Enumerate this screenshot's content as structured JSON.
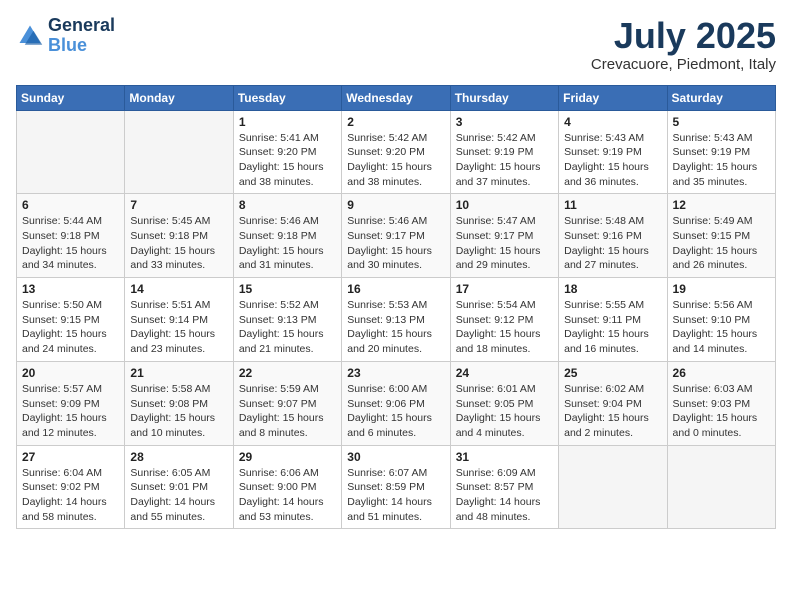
{
  "header": {
    "logo_line1": "General",
    "logo_line2": "Blue",
    "month": "July 2025",
    "location": "Crevacuore, Piedmont, Italy"
  },
  "weekdays": [
    "Sunday",
    "Monday",
    "Tuesday",
    "Wednesday",
    "Thursday",
    "Friday",
    "Saturday"
  ],
  "weeks": [
    [
      {
        "day": "",
        "text": ""
      },
      {
        "day": "",
        "text": ""
      },
      {
        "day": "1",
        "text": "Sunrise: 5:41 AM\nSunset: 9:20 PM\nDaylight: 15 hours and 38 minutes."
      },
      {
        "day": "2",
        "text": "Sunrise: 5:42 AM\nSunset: 9:20 PM\nDaylight: 15 hours and 38 minutes."
      },
      {
        "day": "3",
        "text": "Sunrise: 5:42 AM\nSunset: 9:19 PM\nDaylight: 15 hours and 37 minutes."
      },
      {
        "day": "4",
        "text": "Sunrise: 5:43 AM\nSunset: 9:19 PM\nDaylight: 15 hours and 36 minutes."
      },
      {
        "day": "5",
        "text": "Sunrise: 5:43 AM\nSunset: 9:19 PM\nDaylight: 15 hours and 35 minutes."
      }
    ],
    [
      {
        "day": "6",
        "text": "Sunrise: 5:44 AM\nSunset: 9:18 PM\nDaylight: 15 hours and 34 minutes."
      },
      {
        "day": "7",
        "text": "Sunrise: 5:45 AM\nSunset: 9:18 PM\nDaylight: 15 hours and 33 minutes."
      },
      {
        "day": "8",
        "text": "Sunrise: 5:46 AM\nSunset: 9:18 PM\nDaylight: 15 hours and 31 minutes."
      },
      {
        "day": "9",
        "text": "Sunrise: 5:46 AM\nSunset: 9:17 PM\nDaylight: 15 hours and 30 minutes."
      },
      {
        "day": "10",
        "text": "Sunrise: 5:47 AM\nSunset: 9:17 PM\nDaylight: 15 hours and 29 minutes."
      },
      {
        "day": "11",
        "text": "Sunrise: 5:48 AM\nSunset: 9:16 PM\nDaylight: 15 hours and 27 minutes."
      },
      {
        "day": "12",
        "text": "Sunrise: 5:49 AM\nSunset: 9:15 PM\nDaylight: 15 hours and 26 minutes."
      }
    ],
    [
      {
        "day": "13",
        "text": "Sunrise: 5:50 AM\nSunset: 9:15 PM\nDaylight: 15 hours and 24 minutes."
      },
      {
        "day": "14",
        "text": "Sunrise: 5:51 AM\nSunset: 9:14 PM\nDaylight: 15 hours and 23 minutes."
      },
      {
        "day": "15",
        "text": "Sunrise: 5:52 AM\nSunset: 9:13 PM\nDaylight: 15 hours and 21 minutes."
      },
      {
        "day": "16",
        "text": "Sunrise: 5:53 AM\nSunset: 9:13 PM\nDaylight: 15 hours and 20 minutes."
      },
      {
        "day": "17",
        "text": "Sunrise: 5:54 AM\nSunset: 9:12 PM\nDaylight: 15 hours and 18 minutes."
      },
      {
        "day": "18",
        "text": "Sunrise: 5:55 AM\nSunset: 9:11 PM\nDaylight: 15 hours and 16 minutes."
      },
      {
        "day": "19",
        "text": "Sunrise: 5:56 AM\nSunset: 9:10 PM\nDaylight: 15 hours and 14 minutes."
      }
    ],
    [
      {
        "day": "20",
        "text": "Sunrise: 5:57 AM\nSunset: 9:09 PM\nDaylight: 15 hours and 12 minutes."
      },
      {
        "day": "21",
        "text": "Sunrise: 5:58 AM\nSunset: 9:08 PM\nDaylight: 15 hours and 10 minutes."
      },
      {
        "day": "22",
        "text": "Sunrise: 5:59 AM\nSunset: 9:07 PM\nDaylight: 15 hours and 8 minutes."
      },
      {
        "day": "23",
        "text": "Sunrise: 6:00 AM\nSunset: 9:06 PM\nDaylight: 15 hours and 6 minutes."
      },
      {
        "day": "24",
        "text": "Sunrise: 6:01 AM\nSunset: 9:05 PM\nDaylight: 15 hours and 4 minutes."
      },
      {
        "day": "25",
        "text": "Sunrise: 6:02 AM\nSunset: 9:04 PM\nDaylight: 15 hours and 2 minutes."
      },
      {
        "day": "26",
        "text": "Sunrise: 6:03 AM\nSunset: 9:03 PM\nDaylight: 15 hours and 0 minutes."
      }
    ],
    [
      {
        "day": "27",
        "text": "Sunrise: 6:04 AM\nSunset: 9:02 PM\nDaylight: 14 hours and 58 minutes."
      },
      {
        "day": "28",
        "text": "Sunrise: 6:05 AM\nSunset: 9:01 PM\nDaylight: 14 hours and 55 minutes."
      },
      {
        "day": "29",
        "text": "Sunrise: 6:06 AM\nSunset: 9:00 PM\nDaylight: 14 hours and 53 minutes."
      },
      {
        "day": "30",
        "text": "Sunrise: 6:07 AM\nSunset: 8:59 PM\nDaylight: 14 hours and 51 minutes."
      },
      {
        "day": "31",
        "text": "Sunrise: 6:09 AM\nSunset: 8:57 PM\nDaylight: 14 hours and 48 minutes."
      },
      {
        "day": "",
        "text": ""
      },
      {
        "day": "",
        "text": ""
      }
    ]
  ]
}
